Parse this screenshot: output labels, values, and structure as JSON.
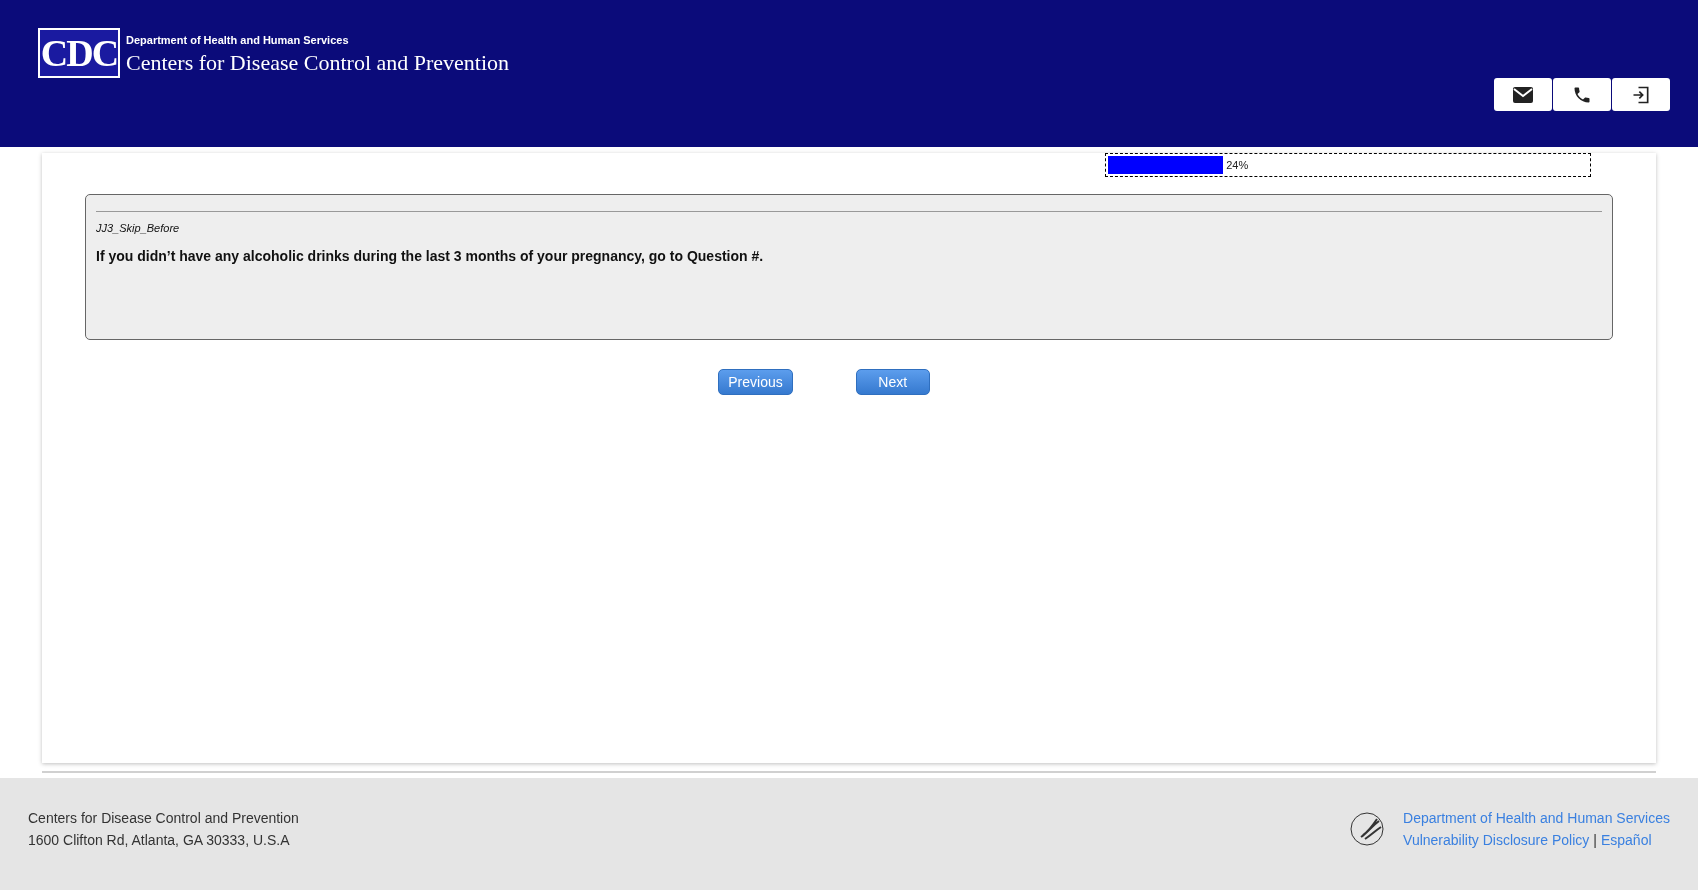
{
  "header": {
    "logo_text": "CDC",
    "department": "Department of Health and Human Services",
    "agency": "Centers for Disease Control and Prevention",
    "actions": [
      {
        "kind": "email"
      },
      {
        "kind": "phone"
      },
      {
        "kind": "exit"
      }
    ]
  },
  "progress": {
    "level": 0.24,
    "reading": "24%"
  },
  "question": {
    "id": "JJ3_Skip_Before",
    "text": "If you didn’t have any alcoholic drinks during the last 3 months of your pregnancy, go to Question #."
  },
  "nav_buttons": [
    "Previous",
    "Next"
  ],
  "footer": {
    "address_lines": [
      "Centers for Disease Control and Prevention",
      "1600 Clifton Rd, Atlanta, GA 30333, U.S.A"
    ],
    "department_link": "Department of Health and Human Services",
    "policy_link": "Vulnerability Disclosure Policy",
    "separator": "|",
    "language_link": "Español"
  }
}
